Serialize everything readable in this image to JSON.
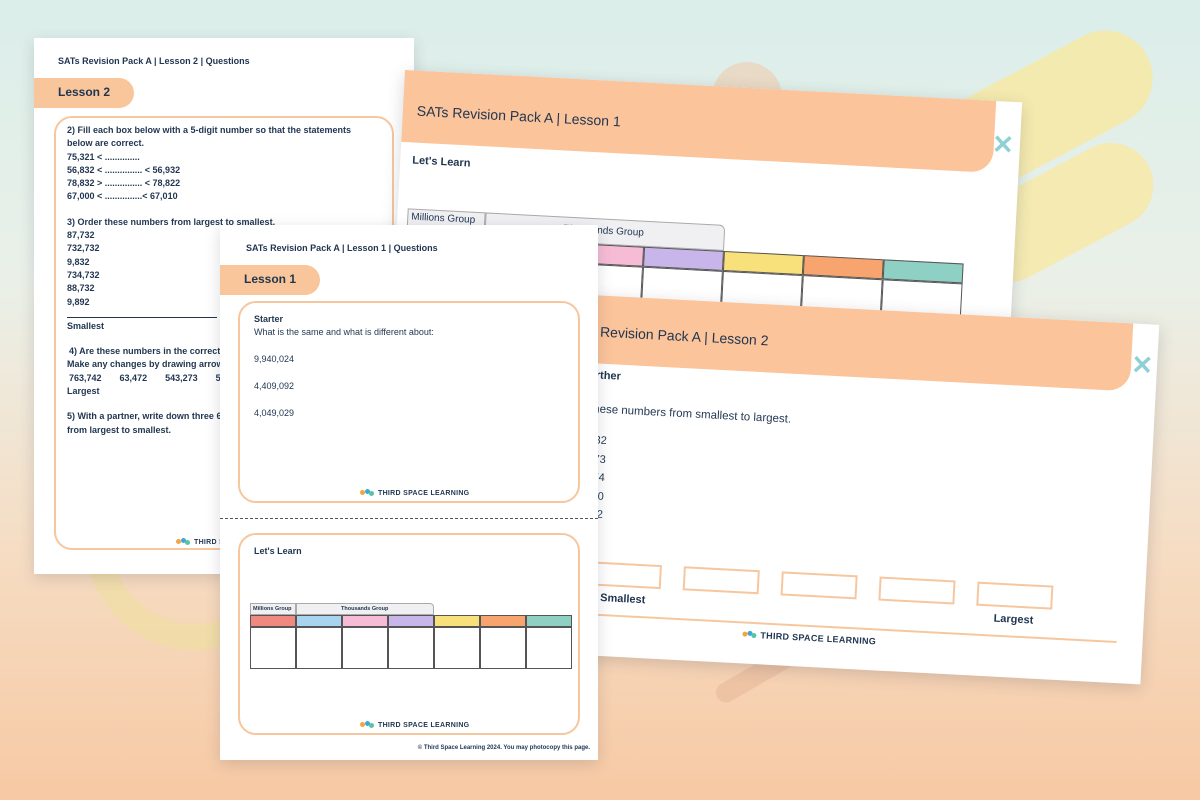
{
  "colors": {
    "accent": "#f9c59a",
    "panel_border": "#f6c79f",
    "text": "#1f3550",
    "close": "#8ed0d6",
    "place_value": [
      "#f08a80",
      "#a8d4f0",
      "#f6bcd6",
      "#c8b6ea",
      "#f8e07a",
      "#f7a46e",
      "#8fd0c4"
    ]
  },
  "sheet_l2q": {
    "caption": "SATs Revision Pack A | Lesson 2 | Questions",
    "pill": "Lesson 2",
    "q2_title": "2) Fill each box below with a 5-digit number so that the statements below are correct.",
    "q2_lines": [
      "75,321 < ..............",
      "56,832 < ............... < 56,932",
      "78,832 > ............... < 78,822",
      "67,000 < ...............< 67,010"
    ],
    "q3_title": "3) Order these numbers from largest to smallest.",
    "q3_lines": [
      "87,732",
      "732,732",
      "9,832",
      "734,732",
      "88,732",
      "9,892"
    ],
    "q3_smallest": "Smallest",
    "q4_title": "4) Are these numbers in the correct order?",
    "q4_subtitle": "Make any changes by drawing arrows t",
    "q4_numbers": [
      "763,742",
      "63,472",
      "543,273",
      "54"
    ],
    "q4_largest": "Largest",
    "q5_title": "5) With a partner, write down three 6-",
    "q5_subtitle": "from largest to smallest.",
    "logo": "THIRD S"
  },
  "sheet_l1q": {
    "caption": "SATs Revision Pack A | Lesson 1 | Questions",
    "pill": "Lesson 1",
    "starter_title": "Starter",
    "starter_question": "What is the same and what is different about:",
    "starter_numbers": [
      "9,940,024",
      "4,409,092",
      "4,049,029"
    ],
    "learn_title": "Let's Learn",
    "millions_group": "Millions Group",
    "thousands_group": "Thousands Group",
    "logo": "THIRD SPACE LEARNING",
    "footer": "© Third Space Learning 2024. You may photocopy this page."
  },
  "slide1": {
    "title": "SATs Revision Pack A | Lesson 1",
    "section": "Let's Learn",
    "millions_group": "Millions Group",
    "thousands_group": "Thousands Group",
    "close_icon": "close-icon"
  },
  "slide2": {
    "title": "Revision Pack A | Lesson 2",
    "section": "rther",
    "instruction": "these numbers from smallest to largest.",
    "numbers": [
      "332",
      "473",
      "974",
      "030",
      "302"
    ],
    "smallest": "Smallest",
    "largest": "Largest",
    "logo": "THIRD SPACE LEARNING",
    "close_icon": "close-icon"
  }
}
